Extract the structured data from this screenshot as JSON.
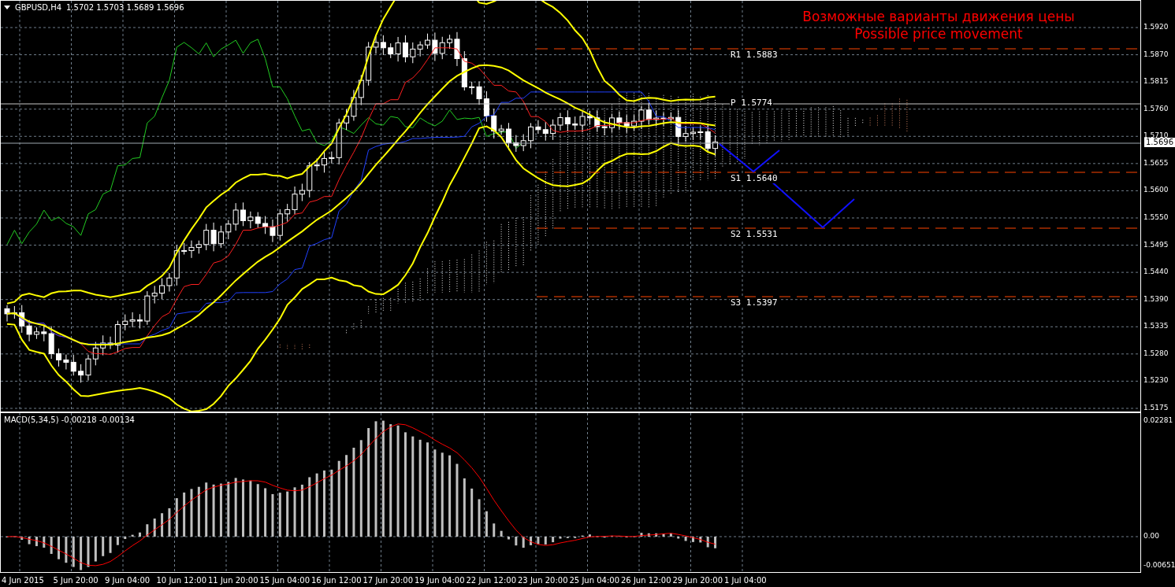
{
  "chart": {
    "symbol": "GBPUSD,H4",
    "ohlc": [
      "1.5702",
      "1.5703",
      "1.5689",
      "1.5696"
    ],
    "caption": [
      "Возможные варианты движения цены",
      "Possible price movement"
    ],
    "levels": [
      {
        "label": "R1 1.5883",
        "kind": "resistance"
      },
      {
        "label": "P 1.5774",
        "kind": "pivot"
      },
      {
        "label": "S1 1.5640",
        "kind": "support"
      },
      {
        "label": "S2 1.5531",
        "kind": "support"
      },
      {
        "label": "S3 1.5397",
        "kind": "support"
      }
    ],
    "price_axis": [
      "1.5920",
      "1.5870",
      "1.5815",
      "1.5760",
      "1.5710",
      "1.5655",
      "1.5600",
      "1.5550",
      "1.5495",
      "1.5440",
      "1.5390",
      "1.5335",
      "1.5280",
      "1.5230",
      "1.5175"
    ],
    "current_price": "1.5696"
  },
  "macd": {
    "title": "MACD(5,34,5) -0.00218 -0.00134",
    "axis": [
      "0.02281",
      "0.00",
      "-0.00651"
    ]
  },
  "time_axis": [
    "4 Jun 2015",
    "5 Jun 20:00",
    "9 Jun 04:00",
    "10 Jun 12:00",
    "11 Jun 20:00",
    "15 Jun 04:00",
    "16 Jun 12:00",
    "17 Jun 20:00",
    "19 Jun 04:00",
    "22 Jun 12:00",
    "23 Jun 20:00",
    "25 Jun 04:00",
    "26 Jun 12:00",
    "29 Jun 20:00",
    "1 Jul 04:00"
  ]
}
